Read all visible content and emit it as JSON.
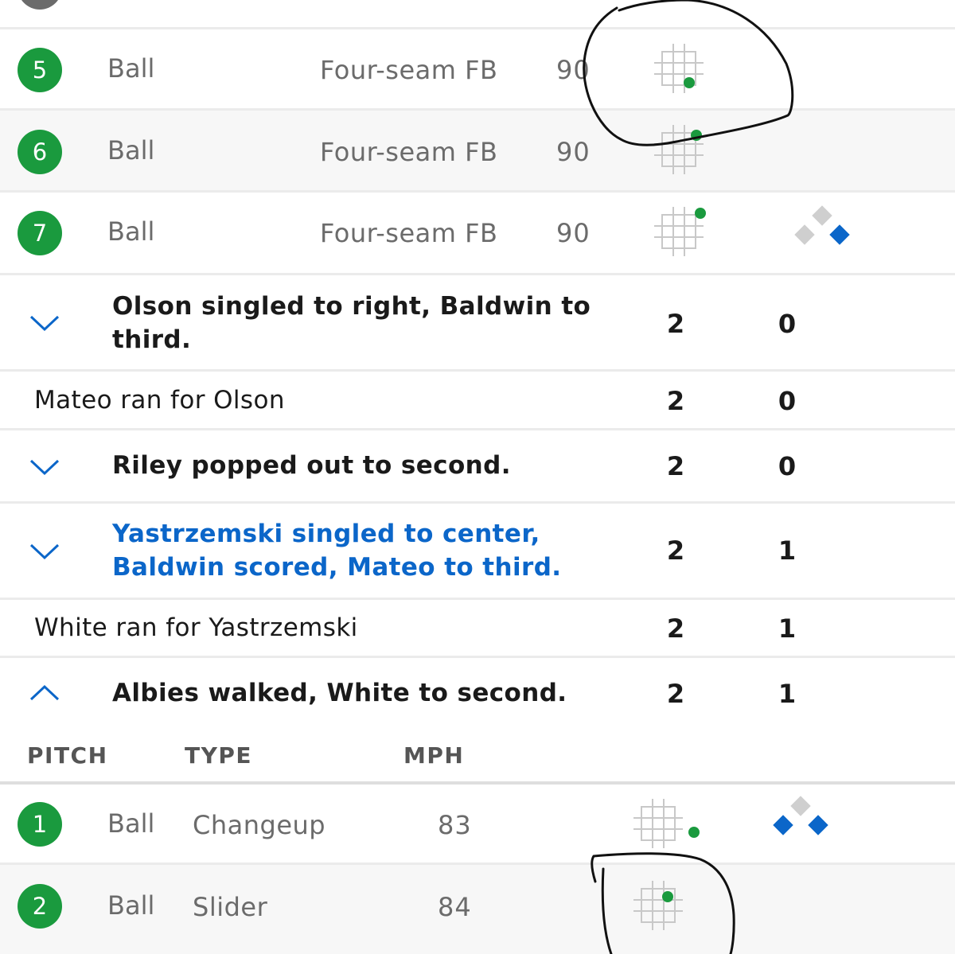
{
  "pitch_rows": [
    {
      "number": "5",
      "result": "Ball",
      "type": "Four-seam FB",
      "mph": "90"
    },
    {
      "number": "6",
      "result": "Ball",
      "type": "Four-seam FB",
      "mph": "90"
    },
    {
      "number": "7",
      "result": "Ball",
      "type": "Four-seam FB",
      "mph": "90"
    }
  ],
  "plays": [
    {
      "line1": "Olson singled to right, Baldwin to",
      "line2": "third.",
      "outs": "2",
      "runs": "0"
    },
    {
      "text": "Mateo ran for Olson",
      "outs": "2",
      "runs": "0"
    },
    {
      "text": "Riley popped out to second.",
      "outs": "2",
      "runs": "0"
    },
    {
      "line1": "Yastrzemski singled to center,",
      "line2": "Baldwin scored, Mateo to third.",
      "outs": "2",
      "runs": "1"
    },
    {
      "text": "White ran for Yastrzemski",
      "outs": "2",
      "runs": "1"
    },
    {
      "text": "Albies walked, White to second.",
      "outs": "2",
      "runs": "1"
    }
  ],
  "pitch_table": {
    "headers": {
      "pitch": "PITCH",
      "type": "TYPE",
      "mph": "MPH"
    },
    "rows": [
      {
        "number": "1",
        "result": "Ball",
        "type": "Changeup",
        "mph": "83"
      },
      {
        "number": "2",
        "result": "Ball",
        "type": "Slider",
        "mph": "84"
      }
    ]
  },
  "colors": {
    "ball_green": "#1a9a3e",
    "accent_blue": "#0b66c9",
    "base_gray": "#cfcfcf",
    "base_occupied": "#0b66c9"
  },
  "icons": [
    "strike-zone-icon",
    "chevron-down-icon",
    "chevron-up-icon",
    "bases-diamond-icon"
  ]
}
